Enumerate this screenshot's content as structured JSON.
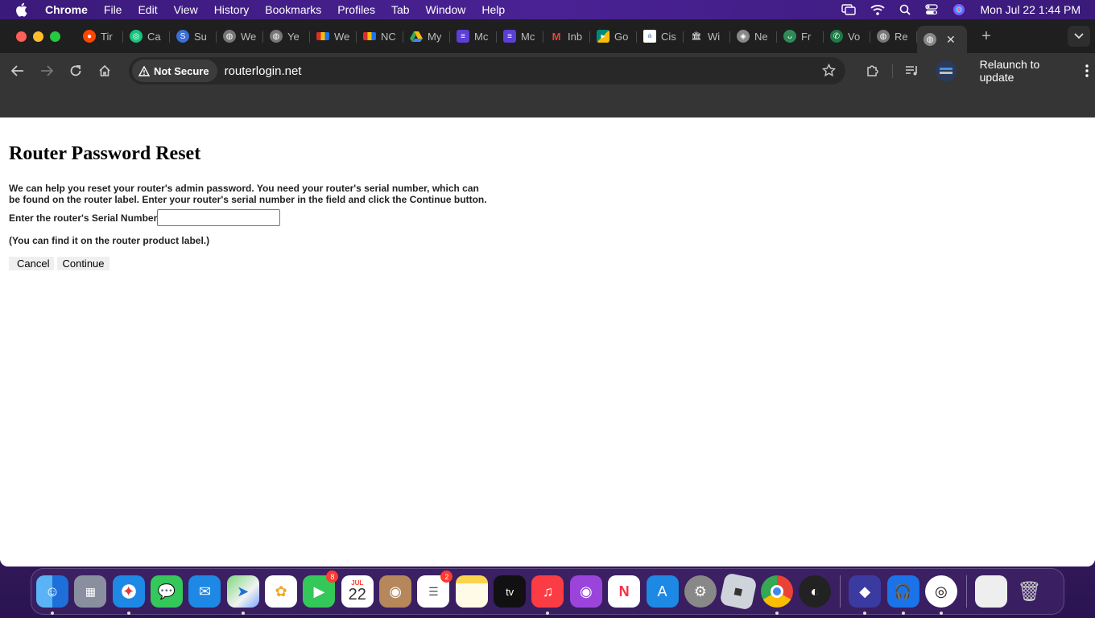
{
  "menubar": {
    "app_name": "Chrome",
    "items": [
      "File",
      "Edit",
      "View",
      "History",
      "Bookmarks",
      "Profiles",
      "Tab",
      "Window",
      "Help"
    ],
    "datetime": "Mon Jul 22  1:44 PM"
  },
  "tabs": [
    {
      "label": "Tir",
      "icon": "reddit-icon",
      "color": "#ff4500"
    },
    {
      "label": "Ca",
      "icon": "chatgpt-icon",
      "color": "#19c37d"
    },
    {
      "label": "Su",
      "icon": "support-icon",
      "color": "#3b6fd6"
    },
    {
      "label": "We",
      "icon": "globe-icon",
      "color": "#777777"
    },
    {
      "label": "Ye",
      "icon": "globe-icon",
      "color": "#777777"
    },
    {
      "label": "We",
      "icon": "flag-icon",
      "color": "#d93025"
    },
    {
      "label": "NC",
      "icon": "flag-icon",
      "color": "#d93025"
    },
    {
      "label": "My",
      "icon": "google-drive-icon",
      "color": "#34a853"
    },
    {
      "label": "Mc",
      "icon": "list-icon",
      "color": "#5b3fd6"
    },
    {
      "label": "Mc",
      "icon": "list-icon",
      "color": "#5b3fd6"
    },
    {
      "label": "Inb",
      "icon": "gmail-icon",
      "color": "#ea4335"
    },
    {
      "label": "Go",
      "icon": "google-meet-icon",
      "color": "#00897b"
    },
    {
      "label": "Cis",
      "icon": "cisco-icon",
      "color": "#ffffff"
    },
    {
      "label": "Wi",
      "icon": "wikipedia-icon",
      "color": "#ffffff"
    },
    {
      "label": "Ne",
      "icon": "netgear-icon",
      "color": "#888888"
    },
    {
      "label": "Fr",
      "icon": "frog-icon",
      "color": "#2e8b57"
    },
    {
      "label": "Vo",
      "icon": "phone-icon",
      "color": "#2ecc71"
    },
    {
      "label": "Re",
      "icon": "globe-icon",
      "color": "#777777"
    }
  ],
  "toolbar": {
    "security_label": "Not Secure",
    "url": "routerlogin.net",
    "relaunch_label": "Relaunch to update"
  },
  "page": {
    "title": "Router Password Reset",
    "intro": "We can help you reset your router's admin password. You need your router's serial number, which can be found on the router label. Enter your router's serial number in the field and click the Continue button.",
    "serial_label": "Enter the router's Serial Number",
    "serial_value": "",
    "hint": "(You can find it on the router product label.)",
    "cancel_label": "Cancel",
    "continue_label": "Continue"
  },
  "dock": {
    "apps": [
      "Finder",
      "Launchpad",
      "Safari",
      "Messages",
      "Mail",
      "Maps",
      "Photos",
      "FaceTime",
      "Calendar",
      "Contacts",
      "Reminders",
      "Notes",
      "TV",
      "Music",
      "Podcasts",
      "News",
      "App Store",
      "System Settings",
      "Roblox",
      "Google Chrome",
      "OBS"
    ],
    "facetime_badge": "8",
    "reminders_badge": "2",
    "calendar_month": "JUL",
    "calendar_day": "22"
  }
}
